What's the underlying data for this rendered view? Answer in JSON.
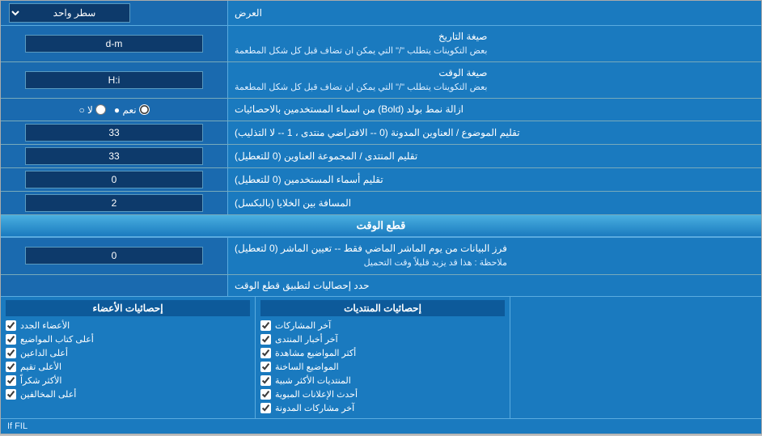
{
  "header": {
    "dropdown_label": "سطر واحد",
    "right_label": "العرض"
  },
  "rows": [
    {
      "id": "date_format",
      "label": "صيغة التاريخ\nبعض التكوينات يتطلب \"/\" التي يمكن ان تضاف قبل كل شكل المطعمة",
      "value": "d-m",
      "type": "input"
    },
    {
      "id": "time_format",
      "label": "صيغة الوقت\nبعض التكوينات يتطلب \"/\" التي يمكن ان تضاف قبل كل شكل المطعمة",
      "value": "H:i",
      "type": "input"
    },
    {
      "id": "bold_remove",
      "label": "ازالة نمط بولد (Bold) من اسماء المستخدمين بالاحصائيات",
      "value": "نعم",
      "value2": "لا",
      "type": "radio",
      "selected": "نعم"
    },
    {
      "id": "topics_order",
      "label": "تقليم الموضوع / العناوين المدونة (0 -- الافتراضي منتدى ، 1 -- لا التذليب)",
      "value": "33",
      "type": "input"
    },
    {
      "id": "forum_order",
      "label": "تقليم المنتدى / المجموعة العناوين (0 للتعطيل)",
      "value": "33",
      "type": "input"
    },
    {
      "id": "usernames_trim",
      "label": "تقليم أسماء المستخدمين (0 للتعطيل)",
      "value": "0",
      "type": "input"
    },
    {
      "id": "cell_spacing",
      "label": "المسافة بين الخلايا (بالبكسل)",
      "value": "2",
      "type": "input"
    }
  ],
  "cutoff_section": {
    "title": "قطع الوقت",
    "row": {
      "label": "فرز البيانات من يوم الماشر الماضي فقط -- تعيين الماشر (0 لتعطيل)\nملاحظة : هذا قد يزيد قليلاً وقت التحميل",
      "value": "0",
      "type": "input"
    },
    "limit_label": "حدد إحصاليات لتطبيق قطع الوقت"
  },
  "checkboxes": {
    "col1": {
      "header": "إحصائيات الأعضاء",
      "items": [
        "الأعضاء الجدد",
        "أعلى كتاب المواضيع",
        "أعلى الداعين",
        "الأعلى تقيم",
        "الأكثر شكراً",
        "أعلى المخالفين"
      ]
    },
    "col2": {
      "header": "إحصائيات المنتديات",
      "items": [
        "آخر المشاركات",
        "آخر أخبار المنتدى",
        "أكثر المواضيع مشاهدة",
        "المواضيع الساخنة",
        "المنتديات الأكثر شبية",
        "أحدث الإعلانات المبوية",
        "آخر مشاركات المدونة"
      ]
    }
  },
  "bottom_text": "If FIL"
}
